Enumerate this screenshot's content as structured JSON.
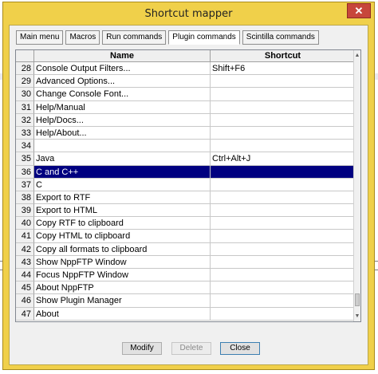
{
  "window": {
    "title": "Shortcut mapper",
    "close_glyph": "✕"
  },
  "tabs": [
    {
      "label": "Main menu"
    },
    {
      "label": "Macros"
    },
    {
      "label": "Run commands"
    },
    {
      "label": "Plugin commands",
      "active": true
    },
    {
      "label": "Scintilla commands"
    }
  ],
  "grid": {
    "headers": {
      "name": "Name",
      "shortcut": "Shortcut"
    },
    "rows": [
      {
        "num": "28",
        "name": "Console Output Filters...",
        "shortcut": "Shift+F6"
      },
      {
        "num": "29",
        "name": "Advanced Options...",
        "shortcut": ""
      },
      {
        "num": "30",
        "name": "Change Console Font...",
        "shortcut": ""
      },
      {
        "num": "31",
        "name": "Help/Manual",
        "shortcut": ""
      },
      {
        "num": "32",
        "name": "Help/Docs...",
        "shortcut": ""
      },
      {
        "num": "33",
        "name": "Help/About...",
        "shortcut": ""
      },
      {
        "num": "34",
        "name": "",
        "shortcut": ""
      },
      {
        "num": "35",
        "name": "Java",
        "shortcut": "Ctrl+Alt+J"
      },
      {
        "num": "36",
        "name": "C and C++",
        "shortcut": "",
        "selected": true
      },
      {
        "num": "37",
        "name": "C",
        "shortcut": ""
      },
      {
        "num": "38",
        "name": "Export to RTF",
        "shortcut": ""
      },
      {
        "num": "39",
        "name": "Export to HTML",
        "shortcut": ""
      },
      {
        "num": "40",
        "name": "Copy RTF to clipboard",
        "shortcut": ""
      },
      {
        "num": "41",
        "name": "Copy HTML to clipboard",
        "shortcut": ""
      },
      {
        "num": "42",
        "name": "Copy all formats to clipboard",
        "shortcut": ""
      },
      {
        "num": "43",
        "name": "Show NppFTP Window",
        "shortcut": ""
      },
      {
        "num": "44",
        "name": "Focus NppFTP Window",
        "shortcut": ""
      },
      {
        "num": "45",
        "name": "About NppFTP",
        "shortcut": ""
      },
      {
        "num": "46",
        "name": "Show Plugin Manager",
        "shortcut": ""
      },
      {
        "num": "47",
        "name": "About",
        "shortcut": ""
      }
    ]
  },
  "buttons": {
    "modify": "Modify",
    "delete": "Delete",
    "close": "Close"
  },
  "colors": {
    "title_bar": "#f0d04a",
    "selection": "#000080",
    "close": "#c7463b"
  }
}
